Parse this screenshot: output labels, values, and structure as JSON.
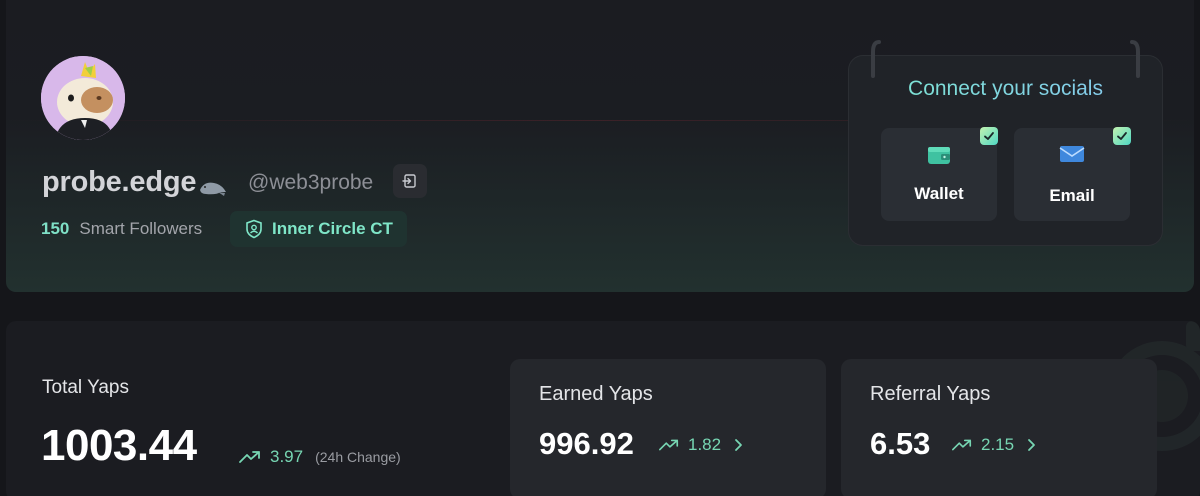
{
  "profile": {
    "display_name": "probe.edge",
    "handle": "@web3probe",
    "smart_followers_count": "150",
    "smart_followers_label": "Smart Followers",
    "badge_label": "Inner Circle CT"
  },
  "socials": {
    "title": "Connect your socials",
    "items": [
      {
        "label": "Wallet",
        "icon": "wallet-icon",
        "connected": true
      },
      {
        "label": "Email",
        "icon": "mail-icon",
        "connected": true
      }
    ]
  },
  "stats": {
    "total": {
      "label": "Total Yaps",
      "value": "1003.44",
      "change": "3.97",
      "change_note": "(24h Change)"
    },
    "earned": {
      "label": "Earned Yaps",
      "value": "996.92",
      "change": "1.82"
    },
    "referral": {
      "label": "Referral Yaps",
      "value": "6.53",
      "change": "2.15"
    }
  },
  "colors": {
    "accent": "#7fe0c6",
    "background": "#15161a",
    "card": "#25272c"
  }
}
